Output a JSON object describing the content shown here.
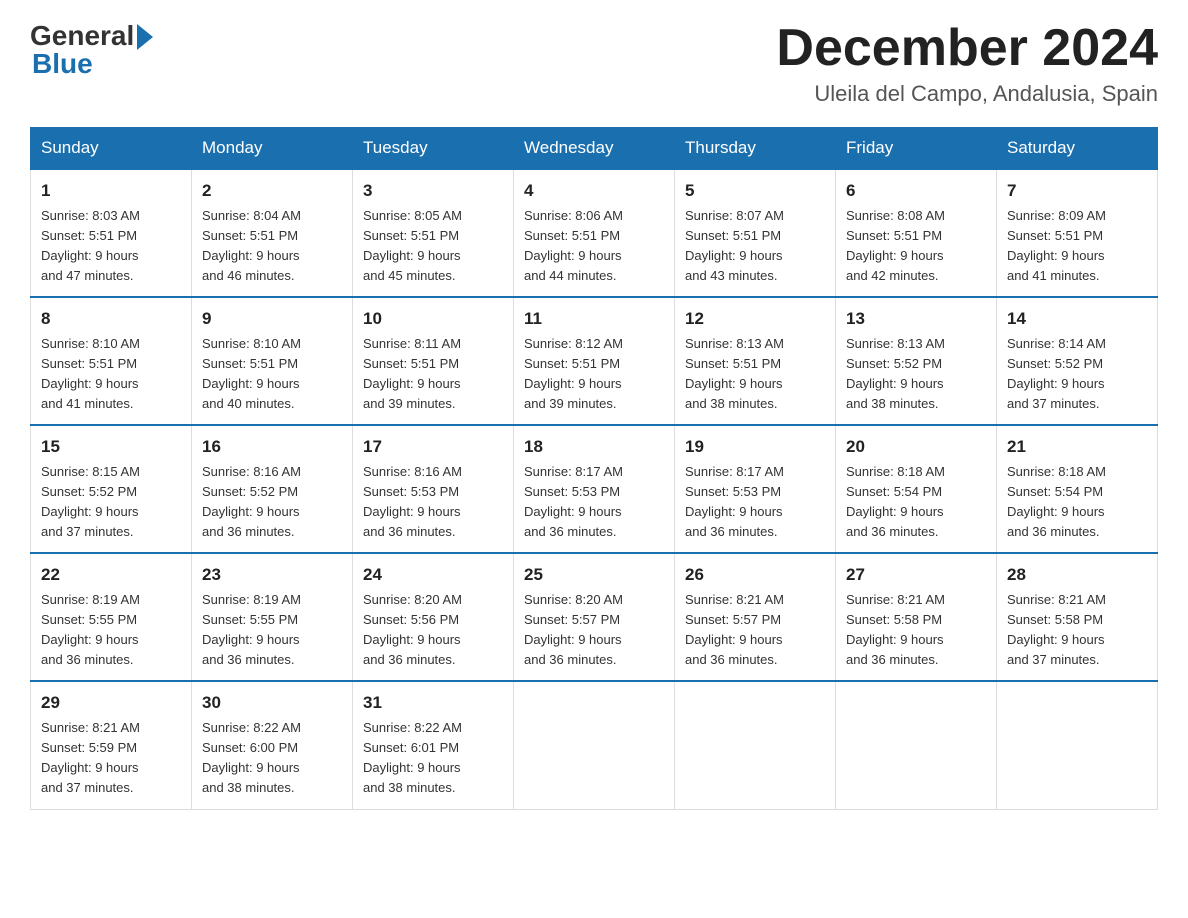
{
  "header": {
    "month_title": "December 2024",
    "location": "Uleila del Campo, Andalusia, Spain"
  },
  "logo": {
    "part1": "General",
    "part2": "Blue"
  },
  "days_of_week": [
    "Sunday",
    "Monday",
    "Tuesday",
    "Wednesday",
    "Thursday",
    "Friday",
    "Saturday"
  ],
  "weeks": [
    [
      {
        "day": "1",
        "sunrise": "8:03 AM",
        "sunset": "5:51 PM",
        "daylight": "9 hours and 47 minutes."
      },
      {
        "day": "2",
        "sunrise": "8:04 AM",
        "sunset": "5:51 PM",
        "daylight": "9 hours and 46 minutes."
      },
      {
        "day": "3",
        "sunrise": "8:05 AM",
        "sunset": "5:51 PM",
        "daylight": "9 hours and 45 minutes."
      },
      {
        "day": "4",
        "sunrise": "8:06 AM",
        "sunset": "5:51 PM",
        "daylight": "9 hours and 44 minutes."
      },
      {
        "day": "5",
        "sunrise": "8:07 AM",
        "sunset": "5:51 PM",
        "daylight": "9 hours and 43 minutes."
      },
      {
        "day": "6",
        "sunrise": "8:08 AM",
        "sunset": "5:51 PM",
        "daylight": "9 hours and 42 minutes."
      },
      {
        "day": "7",
        "sunrise": "8:09 AM",
        "sunset": "5:51 PM",
        "daylight": "9 hours and 41 minutes."
      }
    ],
    [
      {
        "day": "8",
        "sunrise": "8:10 AM",
        "sunset": "5:51 PM",
        "daylight": "9 hours and 41 minutes."
      },
      {
        "day": "9",
        "sunrise": "8:10 AM",
        "sunset": "5:51 PM",
        "daylight": "9 hours and 40 minutes."
      },
      {
        "day": "10",
        "sunrise": "8:11 AM",
        "sunset": "5:51 PM",
        "daylight": "9 hours and 39 minutes."
      },
      {
        "day": "11",
        "sunrise": "8:12 AM",
        "sunset": "5:51 PM",
        "daylight": "9 hours and 39 minutes."
      },
      {
        "day": "12",
        "sunrise": "8:13 AM",
        "sunset": "5:51 PM",
        "daylight": "9 hours and 38 minutes."
      },
      {
        "day": "13",
        "sunrise": "8:13 AM",
        "sunset": "5:52 PM",
        "daylight": "9 hours and 38 minutes."
      },
      {
        "day": "14",
        "sunrise": "8:14 AM",
        "sunset": "5:52 PM",
        "daylight": "9 hours and 37 minutes."
      }
    ],
    [
      {
        "day": "15",
        "sunrise": "8:15 AM",
        "sunset": "5:52 PM",
        "daylight": "9 hours and 37 minutes."
      },
      {
        "day": "16",
        "sunrise": "8:16 AM",
        "sunset": "5:52 PM",
        "daylight": "9 hours and 36 minutes."
      },
      {
        "day": "17",
        "sunrise": "8:16 AM",
        "sunset": "5:53 PM",
        "daylight": "9 hours and 36 minutes."
      },
      {
        "day": "18",
        "sunrise": "8:17 AM",
        "sunset": "5:53 PM",
        "daylight": "9 hours and 36 minutes."
      },
      {
        "day": "19",
        "sunrise": "8:17 AM",
        "sunset": "5:53 PM",
        "daylight": "9 hours and 36 minutes."
      },
      {
        "day": "20",
        "sunrise": "8:18 AM",
        "sunset": "5:54 PM",
        "daylight": "9 hours and 36 minutes."
      },
      {
        "day": "21",
        "sunrise": "8:18 AM",
        "sunset": "5:54 PM",
        "daylight": "9 hours and 36 minutes."
      }
    ],
    [
      {
        "day": "22",
        "sunrise": "8:19 AM",
        "sunset": "5:55 PM",
        "daylight": "9 hours and 36 minutes."
      },
      {
        "day": "23",
        "sunrise": "8:19 AM",
        "sunset": "5:55 PM",
        "daylight": "9 hours and 36 minutes."
      },
      {
        "day": "24",
        "sunrise": "8:20 AM",
        "sunset": "5:56 PM",
        "daylight": "9 hours and 36 minutes."
      },
      {
        "day": "25",
        "sunrise": "8:20 AM",
        "sunset": "5:57 PM",
        "daylight": "9 hours and 36 minutes."
      },
      {
        "day": "26",
        "sunrise": "8:21 AM",
        "sunset": "5:57 PM",
        "daylight": "9 hours and 36 minutes."
      },
      {
        "day": "27",
        "sunrise": "8:21 AM",
        "sunset": "5:58 PM",
        "daylight": "9 hours and 36 minutes."
      },
      {
        "day": "28",
        "sunrise": "8:21 AM",
        "sunset": "5:58 PM",
        "daylight": "9 hours and 37 minutes."
      }
    ],
    [
      {
        "day": "29",
        "sunrise": "8:21 AM",
        "sunset": "5:59 PM",
        "daylight": "9 hours and 37 minutes."
      },
      {
        "day": "30",
        "sunrise": "8:22 AM",
        "sunset": "6:00 PM",
        "daylight": "9 hours and 38 minutes."
      },
      {
        "day": "31",
        "sunrise": "8:22 AM",
        "sunset": "6:01 PM",
        "daylight": "9 hours and 38 minutes."
      },
      null,
      null,
      null,
      null
    ]
  ]
}
